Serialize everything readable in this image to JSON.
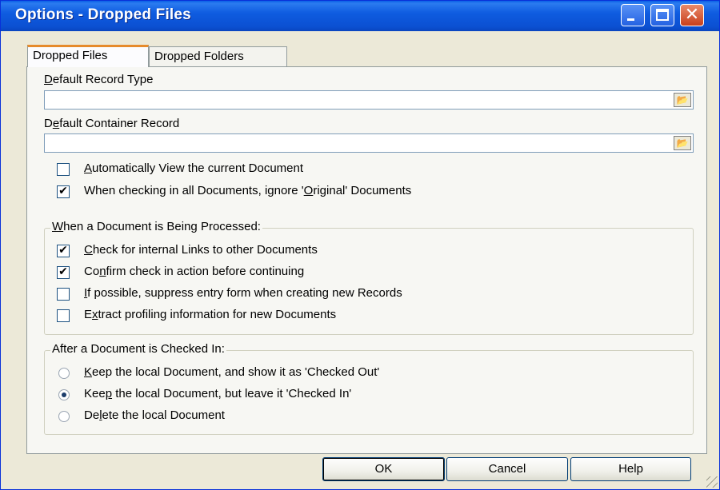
{
  "window": {
    "title": "Options - Dropped Files"
  },
  "tabs": [
    {
      "label": "Dropped Files"
    },
    {
      "label": "Dropped Folders"
    }
  ],
  "fields": {
    "record_type": {
      "label_u": "D",
      "label_rest": "efault Record Type",
      "value": ""
    },
    "container": {
      "label_pre": "D",
      "label_u": "e",
      "label_rest": "fault Container Record",
      "value": ""
    }
  },
  "options": {
    "auto_view": {
      "u": "A",
      "rest": "utomatically View the current Document",
      "checked": false
    },
    "ignore_original": {
      "pre": "When checking in all Documents, ignore '",
      "u": "O",
      "rest": "riginal' Documents",
      "checked": true
    }
  },
  "processing": {
    "legend_u": "W",
    "legend_rest": "hen a Document is Being Processed:",
    "items": [
      {
        "pre": "",
        "u": "C",
        "rest": "heck for internal Links to other Documents",
        "checked": true
      },
      {
        "pre": "Co",
        "u": "n",
        "rest": "firm check in action before continuing",
        "checked": true
      },
      {
        "pre": "",
        "u": "I",
        "rest": "f possible, suppress entry form when creating new Records",
        "checked": false
      },
      {
        "pre": "E",
        "u": "x",
        "rest": "tract profiling information for new Documents",
        "checked": false
      }
    ]
  },
  "checked_in": {
    "legend": "After a Document is Checked In:",
    "items": [
      {
        "pre": "",
        "u": "K",
        "rest": "eep the local Document, and show it as 'Checked Out'",
        "selected": false
      },
      {
        "pre": "Kee",
        "u": "p",
        "rest": " the local Document, but leave it 'Checked In'",
        "selected": true
      },
      {
        "pre": "De",
        "u": "l",
        "rest": "ete the local Document",
        "selected": false
      }
    ]
  },
  "buttons": {
    "ok": "OK",
    "cancel": "Cancel",
    "help": "Help"
  },
  "icons": {
    "browse": "folder-icon",
    "close": "close-icon",
    "minimize": "minimize-icon",
    "maximize": "maximize-icon"
  },
  "colors": {
    "titlebar": "#0b50d2",
    "dialog_bg": "#ece9d8",
    "tab_accent": "#e68b2c"
  }
}
